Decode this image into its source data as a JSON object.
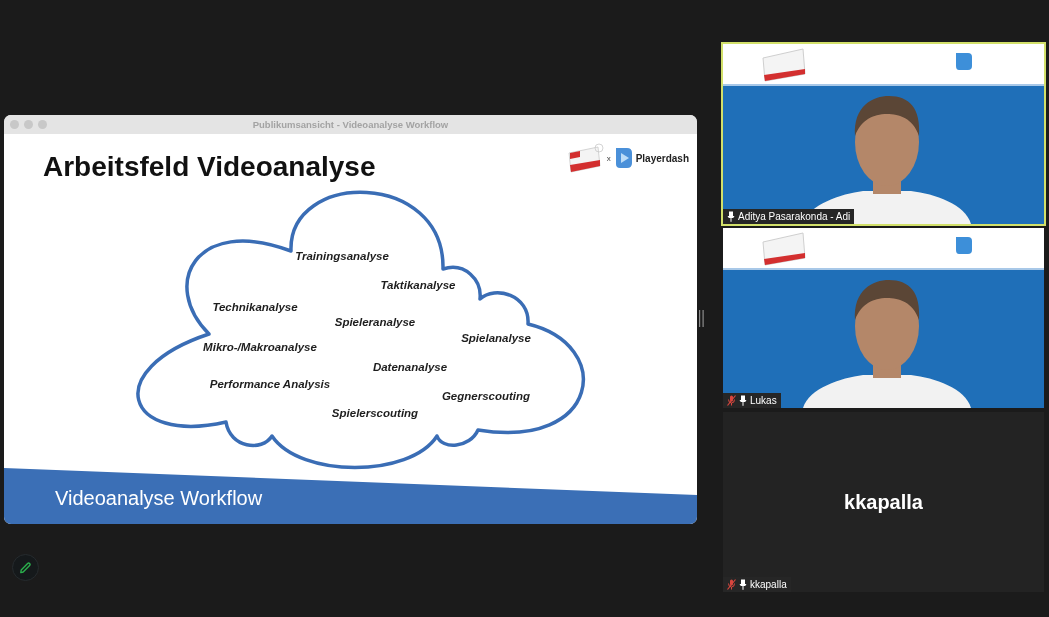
{
  "shared_screen": {
    "window_title": "Publikumsansicht - Videoanalyse Workflow",
    "slide": {
      "heading": "Arbeitsfeld Videoanalyse",
      "logo_separator": "x",
      "brand": "Playerdash",
      "cloud_terms": [
        "Trainingsanalyse",
        "Taktikanalyse",
        "Technikanalyse",
        "Spieleranalyse",
        "Spielanalyse",
        "Mikro-/Makroanalyse",
        "Datenanalyse",
        "Performance Analysis",
        "Gegnerscouting",
        "Spielerscouting"
      ],
      "footer": "Videoanalyse Workflow"
    }
  },
  "participants": [
    {
      "kind": "video",
      "name": "Aditya Pasarakonda - Adi",
      "muted": false,
      "speaking": true
    },
    {
      "kind": "video",
      "name": "Lukas",
      "muted": true,
      "speaking": false
    },
    {
      "kind": "no_video",
      "tile_name": "kkapalla",
      "name": "kkapalla",
      "muted": true,
      "speaking": false
    }
  ]
}
